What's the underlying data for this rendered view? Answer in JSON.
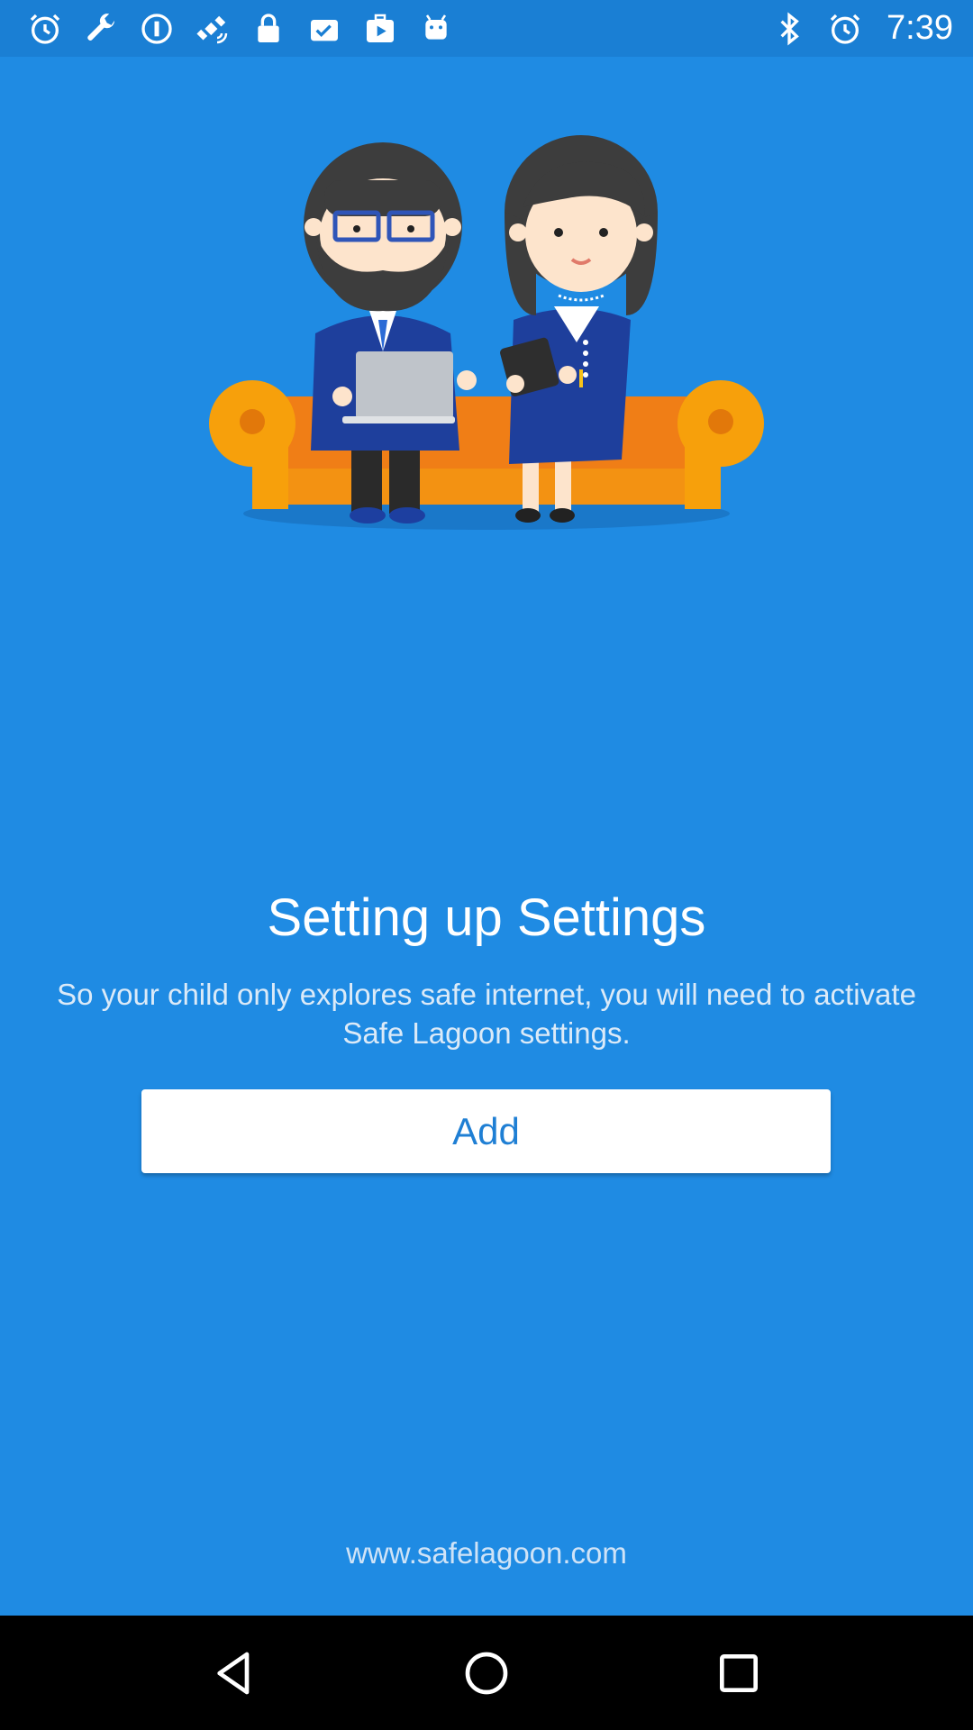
{
  "status_bar": {
    "time": "7:39",
    "left_icons": [
      "alarm-icon",
      "wrench-icon",
      "info-circle-icon",
      "fake-gps-satellite-icon",
      "lock-icon",
      "checklist-icon",
      "play-store-icon",
      "android-icon"
    ],
    "right_icons": [
      "bluetooth-icon",
      "alarm-icon"
    ]
  },
  "main": {
    "title": "Setting up Settings",
    "description": "So your child only explores safe internet, you will need to activate Safe Lagoon settings.",
    "add_button_label": "Add",
    "website": "www.safelagoon.com"
  },
  "nav_bar": {
    "buttons": [
      "back-icon",
      "home-icon",
      "recents-icon"
    ]
  },
  "colors": {
    "background": "#1f8be3",
    "status_bar": "#1a7fd4",
    "button_text": "#1f7fd4",
    "sofa": "#f5890f"
  }
}
